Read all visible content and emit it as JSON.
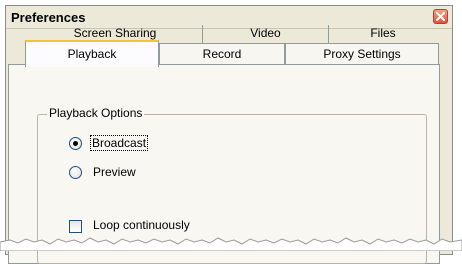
{
  "window": {
    "title": "Preferences"
  },
  "tabs": {
    "row1": [
      "Screen Sharing",
      "Video",
      "Files"
    ],
    "row2": [
      "Playback",
      "Record",
      "Proxy Settings"
    ],
    "active": "Playback"
  },
  "group": {
    "title": "Playback Options",
    "options": [
      {
        "label": "Broadcast",
        "selected": true
      },
      {
        "label": "Preview",
        "selected": false
      }
    ],
    "loop": {
      "label": "Loop continuously",
      "checked": false
    }
  }
}
